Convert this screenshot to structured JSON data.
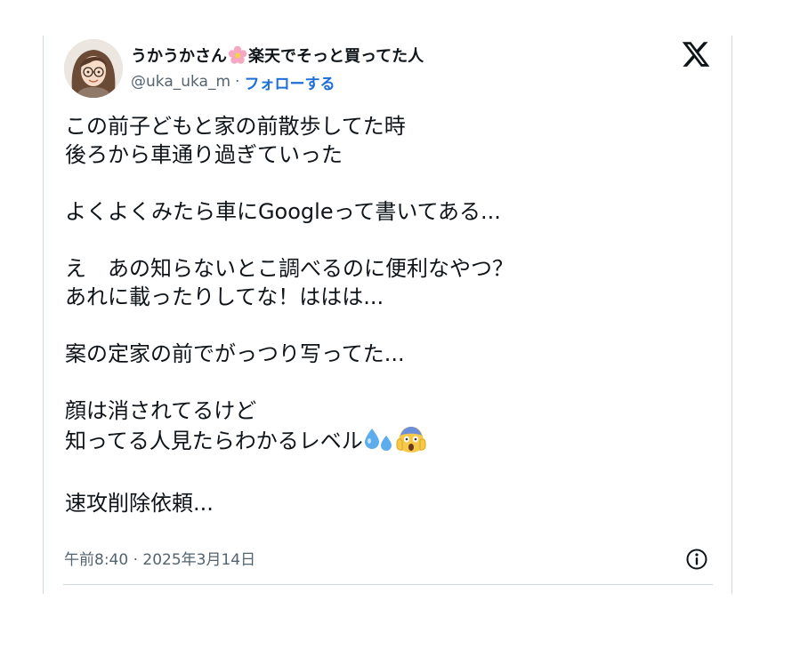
{
  "user": {
    "display_name_part1": "うかうかさん",
    "display_name_part2": "楽天でそっと買ってた人",
    "handle": "@uka_uka_m",
    "separator": "·",
    "follow_label": "フォローする"
  },
  "tweet": {
    "paragraphs": [
      [
        "この前子どもと家の前散歩してた時",
        "後ろから車通り過ぎていった"
      ],
      [
        "よくよくみたら車にGoogleって書いてある..."
      ],
      [
        "え　あの知らないとこ調べるのに便利なやつ？",
        "あれに載ったりしてな！ははは..."
      ],
      [
        "案の定家の前でがっつり写ってた..."
      ],
      [
        "顔は消されてるけど",
        "知ってる人見たらわかるレベル"
      ],
      [
        "速攻削除依頼..."
      ]
    ],
    "emojis": [
      "sweat-droplets-icon",
      "face-screaming-in-fear-icon"
    ],
    "timestamp": "午前8:40 · 2025年3月14日"
  },
  "icons": {
    "brand": "x-logo-icon",
    "info": "info-icon",
    "name_emoji": "cherry-blossom-icon"
  },
  "colors": {
    "text": "#0f1419",
    "secondary": "#536471",
    "link": "#1d6fd8",
    "border": "#cfd9de"
  }
}
